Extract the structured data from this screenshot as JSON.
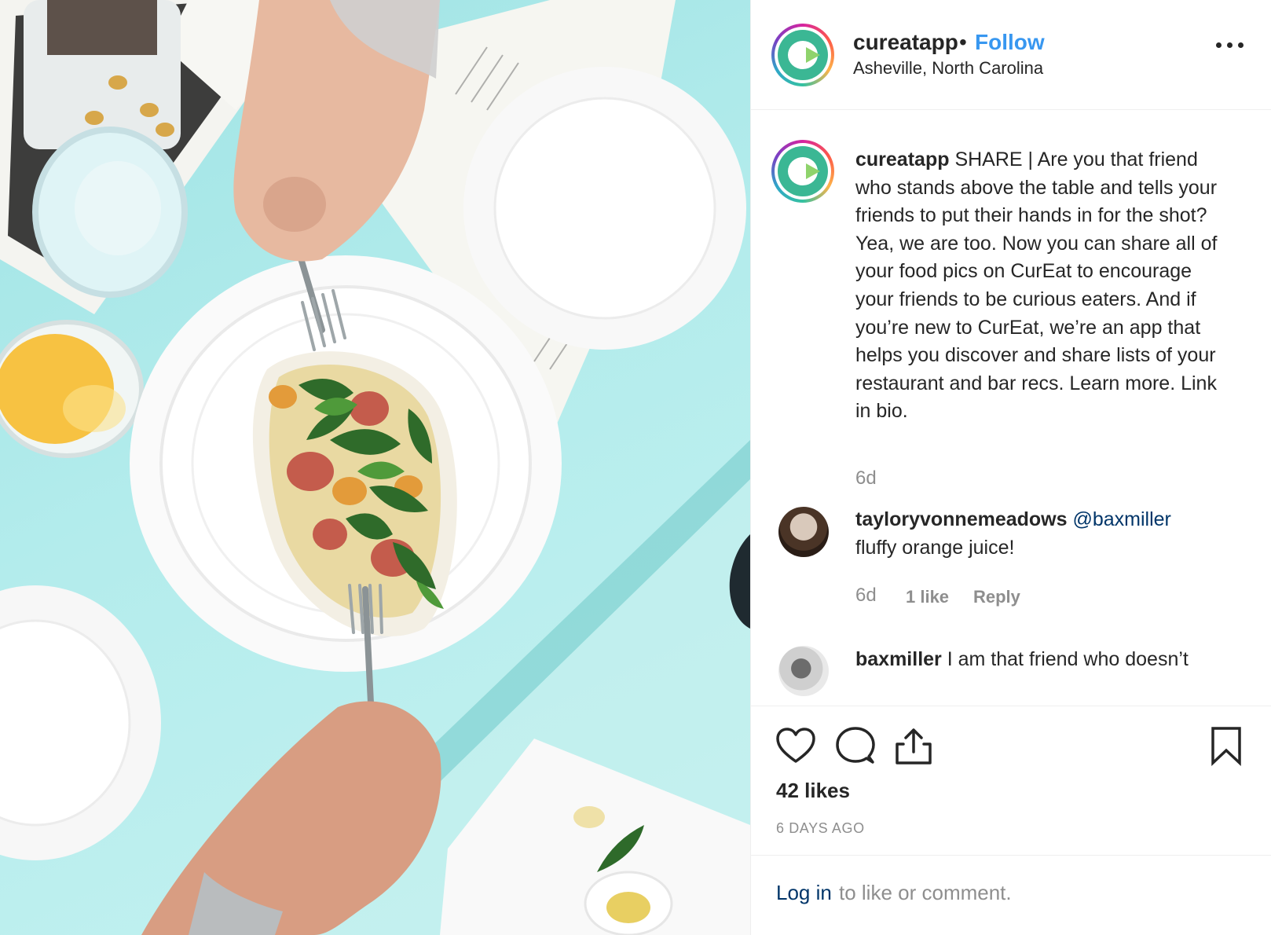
{
  "post": {
    "photo": {
      "description_icon": "food-photo-icon"
    },
    "header": {
      "username": "cureatapp",
      "separator": "•",
      "follow_label": "Follow",
      "location": "Asheville, North Carolina",
      "more_icon": "more-options-icon"
    },
    "caption": {
      "username": "cureatapp",
      "text": "SHARE | Are you that friend who stands above the table and tells your friends to put their hands in for the shot? Yea, we are too. Now you can share all of your food pics on CurEat to encourage your friends to be curious eaters. And if you’re new to CurEat, we’re an app that helps you discover and share lists of your restaurant and bar recs. Learn more. Link in bio.",
      "time": "6d"
    },
    "comments": [
      {
        "username": "tayloryvonnemeadows",
        "mention": "@baxmiller",
        "text": "fluffy orange juice!",
        "time": "6d",
        "likes": "1 like",
        "reply_label": "Reply"
      },
      {
        "username": "baxmiller",
        "text": "I am that friend who doesn’t"
      }
    ],
    "actions": {
      "like_icon": "heart-icon",
      "comment_icon": "comment-icon",
      "share_icon": "share-icon",
      "save_icon": "bookmark-icon"
    },
    "likes_count": "42 likes",
    "age": "6 DAYS AGO",
    "login": {
      "link_label": "Log in",
      "rest": "to like or comment."
    }
  },
  "colors": {
    "link": "#3897f0",
    "mention": "#003569",
    "muted": "#8e8e8e",
    "text": "#262626",
    "table": "#aee9e9"
  }
}
